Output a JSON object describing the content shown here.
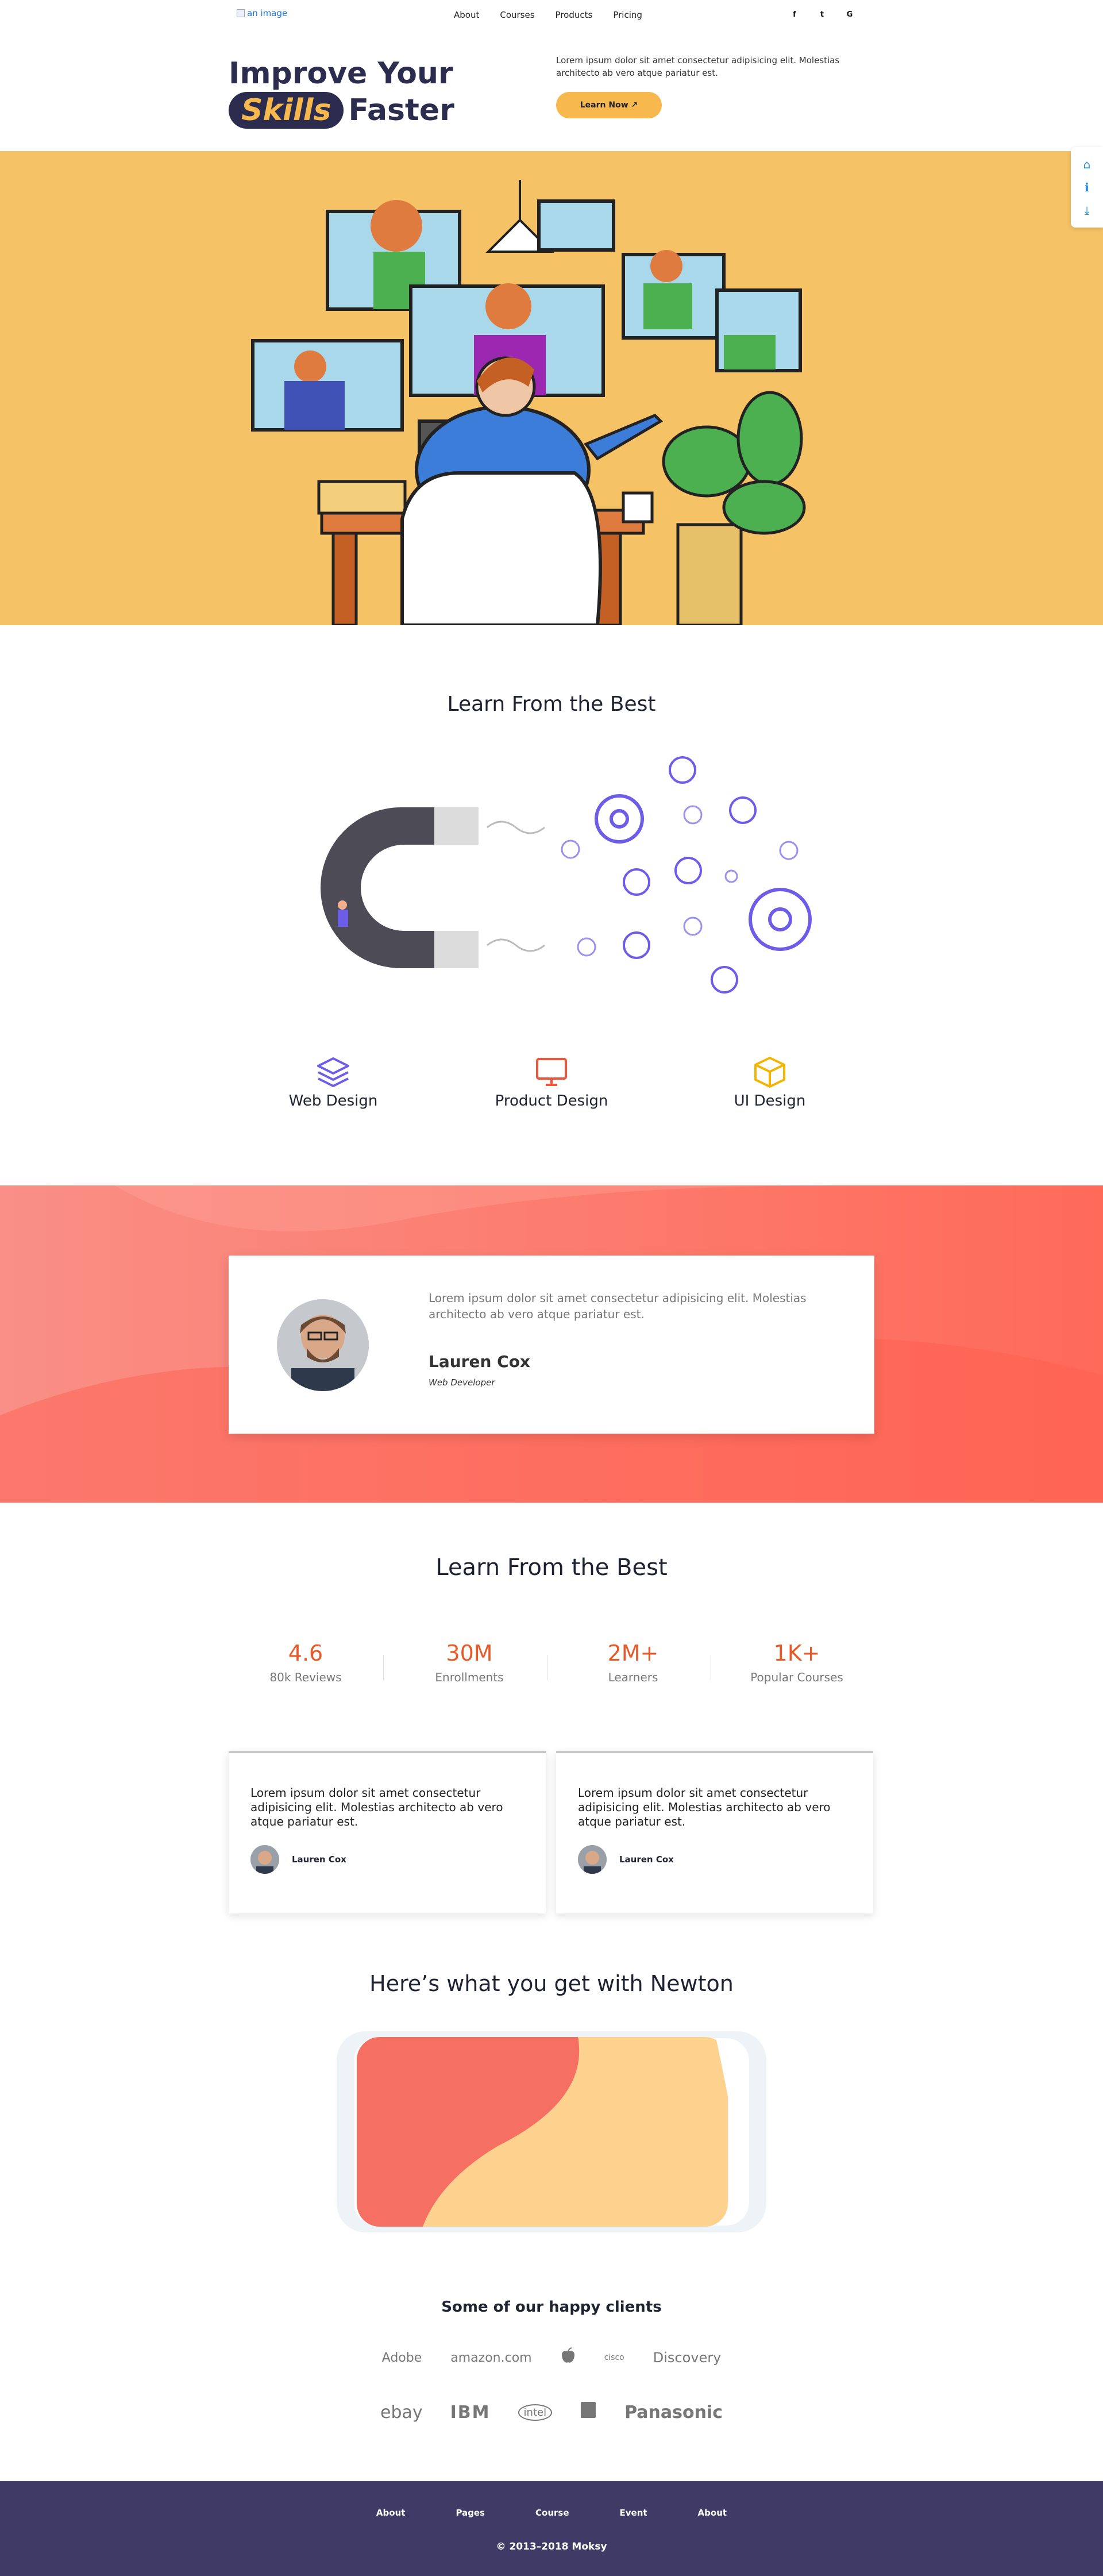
{
  "nav": {
    "logo_alt": "an image",
    "menu": [
      "About",
      "Courses",
      "Products",
      "Pricing"
    ],
    "social": [
      "facebook-icon",
      "twitter-icon",
      "google-icon"
    ],
    "social_glyphs": [
      "f",
      "t",
      "G"
    ]
  },
  "hero": {
    "title_line1": "Improve Your",
    "title_highlight": "Skills",
    "title_line2": "Faster",
    "text": "Lorem ipsum dolor sit amet consectetur adipisicing elit. Molestias architecto ab vero atque pariatur est.",
    "button": "Learn Now ↗"
  },
  "side_dock": {
    "icons": [
      "home-icon",
      "info-icon",
      "download-icon"
    ]
  },
  "section1": {
    "title": "Learn From the Best",
    "categories": [
      {
        "label": "Web Design",
        "icon": "layers-icon",
        "color": "#6c5ce7"
      },
      {
        "label": "Product Design",
        "icon": "monitor-icon",
        "color": "#f0543a"
      },
      {
        "label": "UI Design",
        "icon": "box-icon",
        "color": "#f4b400"
      }
    ]
  },
  "testimonial": {
    "text": "Lorem ipsum dolor sit amet consectetur adipisicing elit. Molestias architecto ab vero atque pariatur est.",
    "name": "Lauren Cox",
    "role": "Web Developer"
  },
  "section2": {
    "title": "Learn From the Best",
    "stats": [
      {
        "value": "4.6",
        "label": "80k Reviews"
      },
      {
        "value": "30M",
        "label": "Enrollments"
      },
      {
        "value": "2M+",
        "label": "Learners"
      },
      {
        "value": "1K+",
        "label": "Popular Courses"
      }
    ],
    "quotes": [
      {
        "text": "Lorem ipsum dolor sit amet consectetur adipisicing elit. Molestias architecto ab vero atque pariatur est.",
        "author": "Lauren Cox"
      },
      {
        "text": "Lorem ipsum dolor sit amet consectetur adipisicing elit. Molestias architecto ab vero atque pariatur est.",
        "author": "Lauren Cox"
      }
    ]
  },
  "section3": {
    "title": "Here’s what you get with Newton"
  },
  "clients": {
    "title": "Some of our happy clients",
    "row1": [
      "Adobe",
      "amazon.com",
      "apple-icon",
      "cisco",
      "Discovery"
    ],
    "row2": [
      "ebay",
      "IBM",
      "intel",
      "kindle-icon",
      "Panasonic"
    ]
  },
  "footer": {
    "menu": [
      "About",
      "Pages",
      "Course",
      "Event",
      "About"
    ],
    "copyright": "© 2013–2018 Moksy"
  },
  "colors": {
    "brand_dark": "#2b2c4e",
    "accent_yellow": "#f6c266",
    "accent_orange": "#e65a2a",
    "coral": "#ff6a59",
    "footer": "#3f3a66",
    "purple": "#6c5ce7"
  }
}
